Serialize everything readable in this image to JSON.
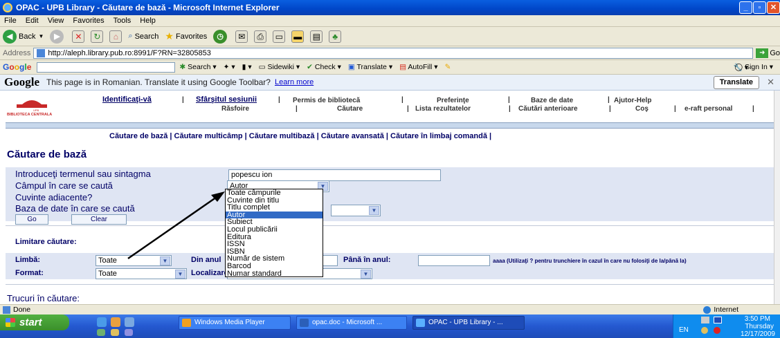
{
  "window": {
    "title": "OPAC - UPB Library - Căutare de bază - Microsoft Internet Explorer"
  },
  "menu": [
    "File",
    "Edit",
    "View",
    "Favorites",
    "Tools",
    "Help"
  ],
  "toolbar": {
    "back": "Back",
    "search": "Search",
    "favorites": "Favorites"
  },
  "address": {
    "label": "Address",
    "url": "http://aleph.library.pub.ro:8991/F?RN=32805853",
    "go": "Go"
  },
  "google_toolbar": {
    "logo": [
      "G",
      "o",
      "o",
      "g",
      "l",
      "e"
    ],
    "search": "Search",
    "sidewiki": "Sidewiki",
    "check": "Check",
    "translate": "Translate",
    "autofill": "AutoFill",
    "signin": "Sign In"
  },
  "translate_bar": {
    "logo": "Google",
    "message": "This page is in Romanian.  Translate it using Google Toolbar?",
    "learn_more": "Learn more",
    "button": "Translate"
  },
  "library": {
    "logo_text": "BIBLIOTECA CENTRALA",
    "logo_small": "UPB",
    "links_row1": [
      "Identificaţi-vă",
      "Sfârşitul sesiunii",
      "Permis de bibliotecă",
      "Preferinţe",
      "Baze de date",
      "Ajutor-Help"
    ],
    "links_row2": [
      "Răsfoire",
      "Căutare",
      "Lista rezultatelor",
      "Căutări anterioare",
      "Coş",
      "e-raft personal"
    ],
    "subnav": "Căutare de bază | Căutare multicâmp | Căutare multibază | Căutare avansată | Căutare în limbaj comandă |",
    "heading": "Căutare de bază"
  },
  "form": {
    "term_label": "Introduceţi termenul sau sintagma",
    "term_value": "popescu ion",
    "field_label": "Câmpul în care se caută",
    "field_value": "Autor",
    "adjacent_label": "Cuvinte adiacente?",
    "db_label": "Baza de date în care se caută",
    "go": "Go",
    "clear": "Clear"
  },
  "dropdown": {
    "options": [
      "Toate câmpurile",
      "Cuvinte din titlu",
      "Titlu complet",
      "Autor",
      "Subiect",
      "Locul publicării",
      "Editura",
      "ISSN",
      "ISBN",
      "Număr de sistem",
      "Barcod",
      "Numar standard"
    ],
    "selected": "Autor"
  },
  "limits": {
    "title": "Limitare căutare:",
    "language_label": "Limbă:",
    "language_value": "Toate",
    "from_label": "Din anul",
    "to_label": "Până în anul:",
    "hint": "aaaa (Utilizaţi ? pentru trunchiere în cazul în care nu folosiţi de la/până la)",
    "format_label": "Format:",
    "format_value": "Toate",
    "location_label": "Localizare"
  },
  "tips_title": "Trucuri în căutare:",
  "status": {
    "text": "Done",
    "zone": "Internet"
  },
  "taskbar": {
    "start": "start",
    "tasks": [
      "Windows Media Player",
      "opac.doc - Microsoft ...",
      "OPAC - UPB Library - ..."
    ],
    "lang": "EN",
    "time": "3:50 PM",
    "day": "Thursday",
    "date": "12/17/2009"
  }
}
